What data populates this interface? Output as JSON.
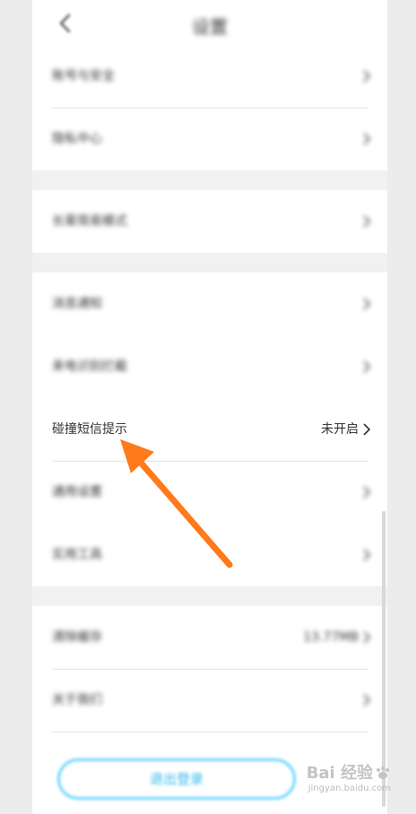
{
  "header": {
    "title": "设置"
  },
  "groups": [
    {
      "rows": [
        {
          "label": "账号与安全",
          "value": ""
        },
        {
          "label": "隐私中心",
          "value": ""
        }
      ]
    },
    {
      "rows": [
        {
          "label": "长辈简易模式",
          "value": ""
        }
      ]
    },
    {
      "rows": [
        {
          "label": "消息通知",
          "value": ""
        },
        {
          "label": "来电识别拦截",
          "value": ""
        },
        {
          "label": "碰撞短信提示",
          "value": "未开启"
        },
        {
          "label": "通用设置",
          "value": ""
        },
        {
          "label": "实用工具",
          "value": ""
        }
      ]
    },
    {
      "rows": [
        {
          "label": "清除缓存",
          "value": "13.77MB"
        },
        {
          "label": "关于我们",
          "value": ""
        }
      ]
    }
  ],
  "logout": {
    "label": "退出登录"
  },
  "watermark": {
    "main": "Bai 经验",
    "sub": "jingyan.baidu.com"
  },
  "colors": {
    "arrow": "#ff7a1a",
    "accent": "#35b8f0"
  },
  "icons": {
    "back": "back-icon",
    "chevron": "chevron-right-icon"
  }
}
